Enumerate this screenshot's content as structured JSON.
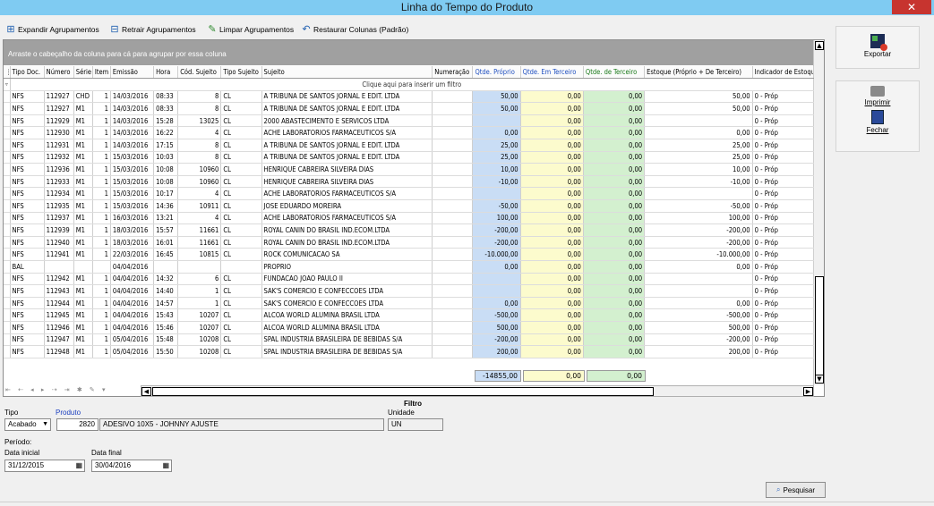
{
  "window": {
    "title": "Linha do Tempo do Produto",
    "close_label": "✕"
  },
  "toolbar": {
    "expand": "Expandir Agrupamentos",
    "retract": "Retrair Agrupamentos",
    "clear": "Limpar Agrupamentos",
    "restore": "Restaurar Colunas (Padrão)"
  },
  "grid": {
    "group_hint": "Arraste o cabeçalho da coluna para cá para agrupar por essa coluna",
    "filter_hint": "Clique aqui para inserir um filtro",
    "headers": [
      "Tipo Doc.",
      "Número",
      "Série",
      "Item",
      "Emissão",
      "Hora",
      "Cód. Sujeito",
      "Tipo Sujeito",
      "Sujeito",
      "Numeração",
      "Qtde. Próprio",
      "Qtde. Em Terceiro",
      "Qtde. de Terceiro",
      "Estoque (Próprio + De Terceiro)",
      "Indicador de Estoque"
    ],
    "rows": [
      [
        "NFS",
        "112927",
        "CHD",
        "1",
        "14/03/2016",
        "08:33",
        "8",
        "CL",
        "A TRIBUNA DE SANTOS JORNAL E EDIT. LTDA",
        "",
        "50,00",
        "0,00",
        "0,00",
        "50,00",
        "0 - Próp"
      ],
      [
        "NFS",
        "112927",
        "M1",
        "1",
        "14/03/2016",
        "08:33",
        "8",
        "CL",
        "A TRIBUNA DE SANTOS JORNAL E EDIT. LTDA",
        "",
        "50,00",
        "0,00",
        "0,00",
        "50,00",
        "0 - Próp"
      ],
      [
        "NFS",
        "112929",
        "M1",
        "1",
        "14/03/2016",
        "15:28",
        "13025",
        "CL",
        "2000 ABASTECIMENTO E SERVICOS LTDA",
        "",
        "",
        "0,00",
        "0,00",
        "",
        "0 - Próp"
      ],
      [
        "NFS",
        "112930",
        "M1",
        "1",
        "14/03/2016",
        "16:22",
        "4",
        "CL",
        "ACHE LABORATORIOS FARMACEUTICOS S/A",
        "",
        "0,00",
        "0,00",
        "0,00",
        "0,00",
        "0 - Próp"
      ],
      [
        "NFS",
        "112931",
        "M1",
        "1",
        "14/03/2016",
        "17:15",
        "8",
        "CL",
        "A TRIBUNA DE SANTOS JORNAL E EDIT. LTDA",
        "",
        "25,00",
        "0,00",
        "0,00",
        "25,00",
        "0 - Próp"
      ],
      [
        "NFS",
        "112932",
        "M1",
        "1",
        "15/03/2016",
        "10:03",
        "8",
        "CL",
        "A TRIBUNA DE SANTOS JORNAL E EDIT. LTDA",
        "",
        "25,00",
        "0,00",
        "0,00",
        "25,00",
        "0 - Próp"
      ],
      [
        "NFS",
        "112936",
        "M1",
        "1",
        "15/03/2016",
        "10:08",
        "10960",
        "CL",
        "HENRIQUE CABREIRA SILVEIRA DIAS",
        "",
        "10,00",
        "0,00",
        "0,00",
        "10,00",
        "0 - Próp"
      ],
      [
        "NFS",
        "112933",
        "M1",
        "1",
        "15/03/2016",
        "10:08",
        "10960",
        "CL",
        "HENRIQUE CABREIRA SILVEIRA DIAS",
        "",
        "-10,00",
        "0,00",
        "0,00",
        "-10,00",
        "0 - Próp"
      ],
      [
        "NFS",
        "112934",
        "M1",
        "1",
        "15/03/2016",
        "10:17",
        "4",
        "CL",
        "ACHE LABORATORIOS FARMACEUTICOS S/A",
        "",
        "",
        "0,00",
        "0,00",
        "",
        "0 - Próp"
      ],
      [
        "NFS",
        "112935",
        "M1",
        "1",
        "15/03/2016",
        "14:36",
        "10911",
        "CL",
        "JOSE EDUARDO MOREIRA",
        "",
        "-50,00",
        "0,00",
        "0,00",
        "-50,00",
        "0 - Próp"
      ],
      [
        "NFS",
        "112937",
        "M1",
        "1",
        "16/03/2016",
        "13:21",
        "4",
        "CL",
        "ACHE LABORATORIOS FARMACEUTICOS S/A",
        "",
        "100,00",
        "0,00",
        "0,00",
        "100,00",
        "0 - Próp"
      ],
      [
        "NFS",
        "112939",
        "M1",
        "1",
        "18/03/2016",
        "15:57",
        "11661",
        "CL",
        "ROYAL CANIN DO BRASIL IND.ECOM.LTDA",
        "",
        "-200,00",
        "0,00",
        "0,00",
        "-200,00",
        "0 - Próp"
      ],
      [
        "NFS",
        "112940",
        "M1",
        "1",
        "18/03/2016",
        "16:01",
        "11661",
        "CL",
        "ROYAL CANIN DO BRASIL IND.ECOM.LTDA",
        "",
        "-200,00",
        "0,00",
        "0,00",
        "-200,00",
        "0 - Próp"
      ],
      [
        "NFS",
        "112941",
        "M1",
        "1",
        "22/03/2016",
        "16:45",
        "10815",
        "CL",
        "ROCK COMUNICACAO SA",
        "",
        "-10.000,00",
        "0,00",
        "0,00",
        "-10.000,00",
        "0 - Próp"
      ],
      [
        "BAL",
        "",
        "",
        "",
        "04/04/2016",
        "",
        "",
        "",
        "PROPRIO",
        "",
        "0,00",
        "0,00",
        "0,00",
        "0,00",
        "0 - Próp"
      ],
      [
        "NFS",
        "112942",
        "M1",
        "1",
        "04/04/2016",
        "14:32",
        "6",
        "CL",
        "FUNDACAO JOAO PAULO II",
        "",
        "",
        "0,00",
        "0,00",
        "",
        "0 - Próp"
      ],
      [
        "NFS",
        "112943",
        "M1",
        "1",
        "04/04/2016",
        "14:40",
        "1",
        "CL",
        "SAK'S COMERCIO E CONFECCOES LTDA",
        "",
        "",
        "0,00",
        "0,00",
        "",
        "0 - Próp"
      ],
      [
        "NFS",
        "112944",
        "M1",
        "1",
        "04/04/2016",
        "14:57",
        "1",
        "CL",
        "SAK'S COMERCIO E CONFECCOES LTDA",
        "",
        "0,00",
        "0,00",
        "0,00",
        "0,00",
        "0 - Próp"
      ],
      [
        "NFS",
        "112945",
        "M1",
        "1",
        "04/04/2016",
        "15:43",
        "10207",
        "CL",
        "ALCOA WORLD ALUMINA BRASIL LTDA",
        "",
        "-500,00",
        "0,00",
        "0,00",
        "-500,00",
        "0 - Próp"
      ],
      [
        "NFS",
        "112946",
        "M1",
        "1",
        "04/04/2016",
        "15:46",
        "10207",
        "CL",
        "ALCOA WORLD ALUMINA BRASIL LTDA",
        "",
        "500,00",
        "0,00",
        "0,00",
        "500,00",
        "0 - Próp"
      ],
      [
        "NFS",
        "112947",
        "M1",
        "1",
        "05/04/2016",
        "15:48",
        "10208",
        "CL",
        "SPAL INDUSTRIA BRASILEIRA DE BEBIDAS S/A",
        "",
        "-200,00",
        "0,00",
        "0,00",
        "-200,00",
        "0 - Próp"
      ],
      [
        "NFS",
        "112948",
        "M1",
        "1",
        "05/04/2016",
        "15:50",
        "10208",
        "CL",
        "SPAL INDUSTRIA BRASILEIRA DE BEBIDAS S/A",
        "",
        "200,00",
        "0,00",
        "0,00",
        "200,00",
        "0 - Próp"
      ]
    ],
    "totals": {
      "proprio": "-14855,00",
      "em_terceiro": "0,00",
      "de_terceiro": "0,00"
    }
  },
  "filter": {
    "section_title": "Filtro",
    "tipo_label": "Tipo",
    "tipo_value": "Acabado",
    "produto_label": "Produto",
    "produto_code": "2820",
    "produto_desc": "ADESIVO 10X5 - JOHNNY AJUSTE",
    "unidade_label": "Unidade",
    "unidade_value": "UN",
    "periodo_label": "Período:",
    "data_inicial_label": "Data inicial",
    "data_inicial_value": "31/12/2015",
    "data_final_label": "Data final",
    "data_final_value": "30/04/2016",
    "pesquisar": "Pesquisar"
  },
  "side": {
    "exportar": "Exportar",
    "imprimir": "Imprimir",
    "fechar": "Fechar"
  },
  "colors": {
    "titlebar": "#7fcbf2",
    "close": "#c7342f",
    "proprio": "#c9ddf5",
    "terceiro": "#fcfbcd",
    "de_terceiro": "#d3f0cf"
  }
}
